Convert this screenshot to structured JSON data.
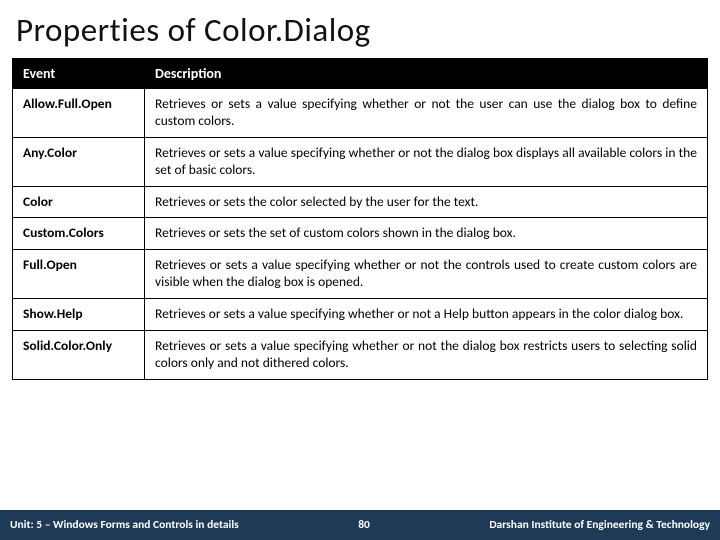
{
  "title": "Properties of Color.Dialog",
  "headers": {
    "event": "Event",
    "description": "Description"
  },
  "rows": [
    {
      "event": "Allow.Full.Open",
      "description": "Retrieves or sets a value specifying whether or not the user can use the dialog box to define custom colors."
    },
    {
      "event": "Any.Color",
      "description": "Retrieves or sets a value specifying whether or not the dialog box displays all available colors in the set of basic colors."
    },
    {
      "event": "Color",
      "description": "Retrieves or sets the color selected by the user for the text."
    },
    {
      "event": "Custom.Colors",
      "description": "Retrieves or sets the set of custom colors shown in the dialog box."
    },
    {
      "event": "Full.Open",
      "description": "Retrieves or sets a value specifying whether or not the controls used to create custom colors are visible when the dialog box is opened."
    },
    {
      "event": "Show.Help",
      "description": "Retrieves or sets a value specifying whether or not a Help button appears in the color dialog box."
    },
    {
      "event": "Solid.Color.Only",
      "description": "Retrieves or sets a value specifying whether or not the dialog box restricts users to selecting solid colors only and not dithered colors."
    }
  ],
  "footer": {
    "unit": "Unit: 5 – Windows Forms and Controls in details",
    "page": "80",
    "institute": "Darshan Institute of Engineering & Technology"
  }
}
